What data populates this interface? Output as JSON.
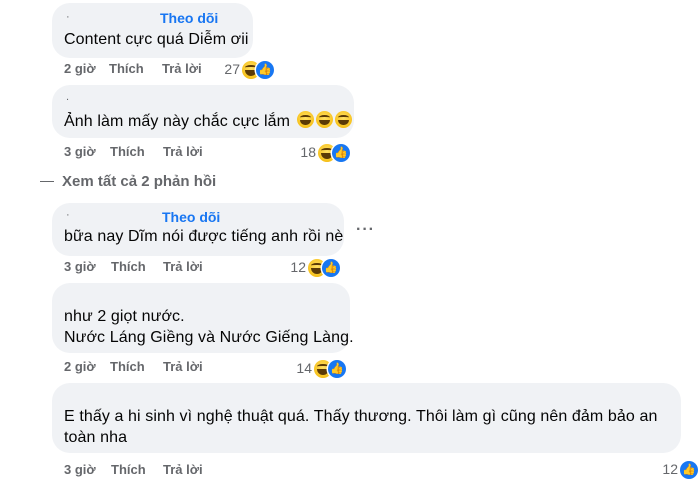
{
  "comments": [
    {
      "name_fragment": "·",
      "follow": "Theo dõi",
      "lines": [
        "Content cực quá Diễm ơii"
      ],
      "time": "2 giờ",
      "like": "Thích",
      "reply": "Trả lời",
      "reaction_count": "27"
    },
    {
      "name_fragment": ".",
      "follow": "",
      "lines": [
        "Ảnh làm mấy này chắc cực lắm"
      ],
      "time": "3 giờ",
      "like": "Thích",
      "reply": "Trả lời",
      "reaction_count": "18"
    },
    {
      "name_fragment": "·",
      "follow": "Theo dõi",
      "lines": [
        "bữa nay Dĩm nói được tiếng anh rồi nè"
      ],
      "time": "3 giờ",
      "like": "Thích",
      "reply": "Trả lời",
      "reaction_count": "12"
    },
    {
      "name_fragment": "",
      "follow": "",
      "lines": [
        "như 2 giọt nước.",
        "Nước Láng Giềng và Nước Giếng Làng."
      ],
      "time": "2 giờ",
      "like": "Thích",
      "reply": "Trả lời",
      "reaction_count": "14"
    },
    {
      "name_fragment": "",
      "follow": "",
      "lines": [
        "E thấy a hi sinh vì nghệ thuật quá. Thấy thương. Thôi làm gì cũng nên đảm bảo an",
        "toàn nha"
      ],
      "time": "3 giờ",
      "like": "Thích",
      "reply": "Trả lời",
      "reaction_count": "12"
    }
  ],
  "view_replies": "Xem tất cả 2 phản hồi",
  "more_options": "···",
  "icons": {
    "haha": "haha-emoji-icon",
    "like": "like-thumb-icon"
  },
  "colors": {
    "bubble": "#f0f2f5",
    "link": "#1876f2",
    "meta": "#65676b",
    "like": "#1877f2"
  }
}
